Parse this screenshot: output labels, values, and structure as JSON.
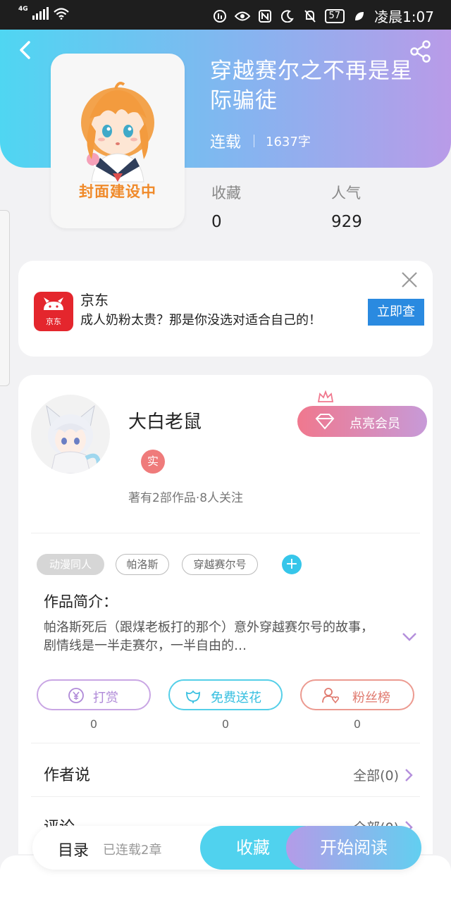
{
  "status_bar": {
    "network": "4G",
    "battery": "57",
    "time": "凌晨1:07"
  },
  "book": {
    "title": "穿越赛尔之不再是星际骗徒",
    "status": "连载",
    "word_count": "1637字",
    "cover_placeholder": "封面建设中",
    "stats": {
      "favorites_label": "收藏",
      "favorites_value": "0",
      "popularity_label": "人气",
      "popularity_value": "929"
    }
  },
  "ad": {
    "brand": "京东",
    "logo_text": "京东",
    "text": "成人奶粉太贵？那是你没选对适合自己的！",
    "cta": "立即查"
  },
  "author": {
    "name": "大白老鼠",
    "verified_badge": "实",
    "stats": "著有2部作品·8人关注",
    "vip_button": "点亮会员"
  },
  "tags": [
    "动漫同人",
    "帕洛斯",
    "穿越赛尔号"
  ],
  "intro": {
    "heading": "作品简介：",
    "text": "帕洛斯死后（跟煤老板打的那个）意外穿越赛尔号的故事，剧情线是一半走赛尔，一半自由的…"
  },
  "actions": {
    "reward_label": "打赏",
    "reward_count": "0",
    "flower_label": "免费送花",
    "flower_count": "0",
    "fans_label": "粉丝榜",
    "fans_count": "0"
  },
  "sections": {
    "author_says": "作者说",
    "author_says_all": "全部(0)",
    "comments": "评论",
    "comments_all": "全部(0)"
  },
  "bottom": {
    "toc": "目录",
    "toc_status": "已连载2章",
    "favorite": "收藏",
    "start_reading": "开始阅读"
  },
  "colors": {
    "header_gradient_start": "#4fd6f2",
    "header_gradient_end": "#b99be8",
    "accent_cyan": "#36c6ea",
    "reward_purple": "#c79ad8",
    "fans_red": "#e07a6f",
    "jd_red": "#e4262d"
  }
}
